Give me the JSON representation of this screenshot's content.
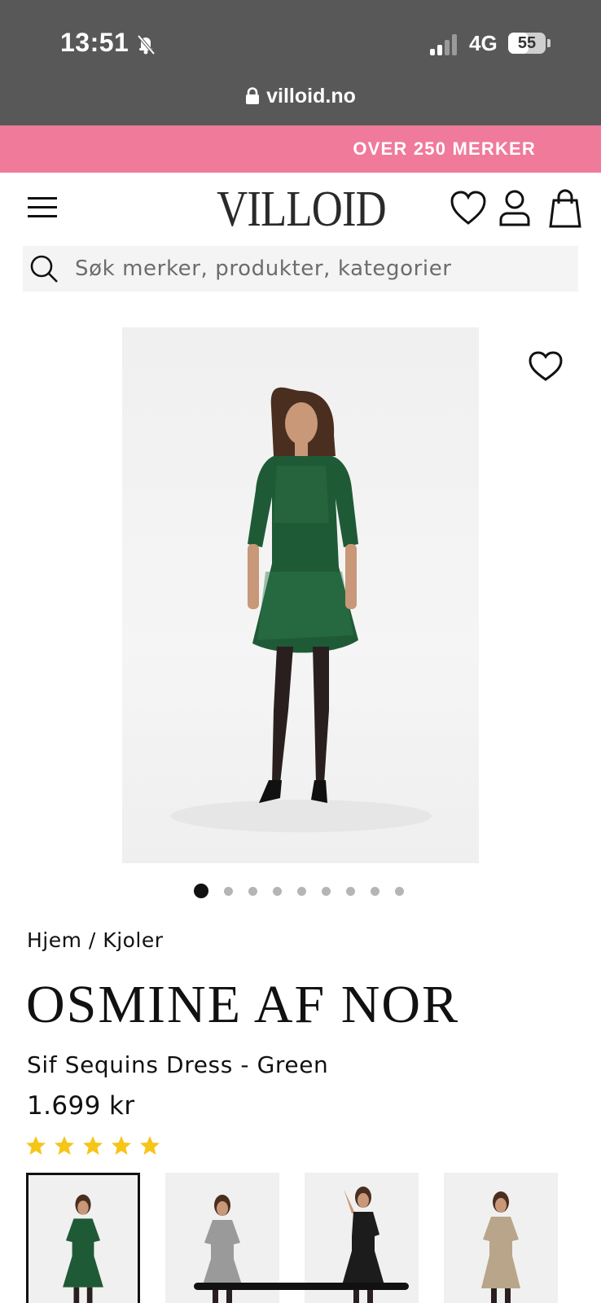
{
  "status_bar": {
    "time": "13:51",
    "network": "4G",
    "battery": "55",
    "battery_level": 0.55
  },
  "browser": {
    "url": "villoid.no"
  },
  "promo": {
    "text": "OVER 250 MERKER"
  },
  "header": {
    "logo": "VILLOID"
  },
  "search": {
    "placeholder": "Søk merker, produkter, kategorier"
  },
  "gallery": {
    "image_count": 9,
    "active_index": 0
  },
  "breadcrumb": "Hjem / Kjoler",
  "product": {
    "brand": "OSMINE AF NOR",
    "name": "Sif Sequins Dress - Green",
    "price": "1.699 kr",
    "rating": 5,
    "rating_max": 5
  },
  "thumbnails": [
    {
      "color": "green",
      "selected": true
    },
    {
      "color": "silver",
      "selected": false
    },
    {
      "color": "black",
      "selected": false
    },
    {
      "color": "gold",
      "selected": false
    }
  ],
  "colors": {
    "promo": "#f07a9a",
    "status_bar": "#585858",
    "star": "#f5c518"
  },
  "icons": [
    "bell-slash-icon",
    "signal-icon",
    "battery-icon",
    "lock-icon",
    "menu-icon",
    "heart-icon",
    "user-icon",
    "bag-icon",
    "search-icon",
    "star-icon"
  ]
}
